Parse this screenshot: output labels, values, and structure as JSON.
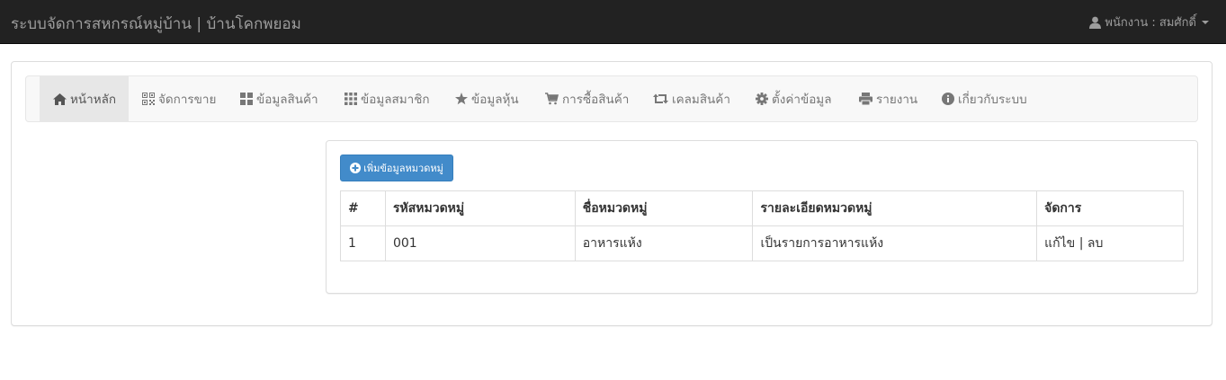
{
  "navbar": {
    "brand": "ระบบจัดการสหกรณ์หมู่บ้าน | บ้านโคกพยอม",
    "user_label": "พนักงาน : สมศักดิ์"
  },
  "menu": {
    "items": [
      {
        "label": "หน้าหลัก",
        "icon": "home-icon",
        "active": true
      },
      {
        "label": "จัดการขาย",
        "icon": "qrcode-icon"
      },
      {
        "label": "ข้อมูลสินค้า",
        "icon": "th-large-icon"
      },
      {
        "label": "ข้อมูลสมาชิก",
        "icon": "th-icon"
      },
      {
        "label": "ข้อมูลหุ้น",
        "icon": "star-icon"
      },
      {
        "label": "การซื้อสินค้า",
        "icon": "shopping-cart-icon"
      },
      {
        "label": "เคลมสินค้า",
        "icon": "retweet-icon"
      },
      {
        "label": "ตั้งค่าข้อมูล",
        "icon": "cog-icon"
      },
      {
        "label": "รายงาน",
        "icon": "print-icon"
      },
      {
        "label": "เกี่ยวกับระบบ",
        "icon": "info-sign-icon"
      }
    ]
  },
  "content": {
    "add_button_label": "เพิ่มข้อมูลหมวดหมู่",
    "table": {
      "headers": [
        "#",
        "รหัสหมวดหมู่",
        "ชื่อหมวดหมู่",
        "รายละเอียดหมวดหมู่",
        "จัดการ"
      ],
      "rows": [
        {
          "num": "1",
          "code": "001",
          "name": "อาหารแห้ง",
          "detail": "เป็นรายการอาหารแห้ง",
          "edit": "แก้ไข",
          "sep": "|",
          "delete": "ลบ"
        }
      ]
    }
  },
  "colors": {
    "navbar_bg": "#222222",
    "navbar_text": "#9d9d9d",
    "primary_button": "#428bca",
    "menu_bg": "#f8f8f8",
    "menu_active_bg": "#e7e7e7"
  }
}
